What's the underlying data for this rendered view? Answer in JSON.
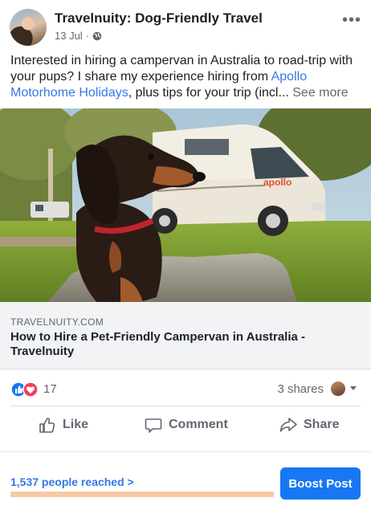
{
  "post": {
    "page_name": "Travelnuity: Dog-Friendly Travel",
    "date": "13 Jul",
    "separator": "·",
    "privacy_icon": "globe-icon",
    "more_icon": "ellipsis-icon",
    "text_intro": "Interested in hiring a campervan in Australia to road-trip with your pups? I share my experience hiring from ",
    "text_link": "Apollo Motorhome Holidays",
    "text_rest": ", plus tips for your trip (incl...",
    "see_more": " See more"
  },
  "link_preview": {
    "domain": "TRAVELNUITY.COM",
    "title": "How to Hire a Pet-Friendly Campervan in Australia - Travelnuity",
    "image_icon": "dachshund-campervan-photo",
    "van_brand": "apollo"
  },
  "engagement": {
    "reactions_count": "17",
    "reaction_icons": [
      "like-icon",
      "love-icon"
    ],
    "shares": "3 shares"
  },
  "actions": [
    {
      "label": "Like",
      "icon": "thumbs-up-icon"
    },
    {
      "label": "Comment",
      "icon": "comment-icon"
    },
    {
      "label": "Share",
      "icon": "share-icon"
    }
  ],
  "footer": {
    "reach": "1,537 people reached",
    "reach_chevron": ">",
    "boost_label": "Boost Post"
  },
  "colors": {
    "accent": "#1877f2",
    "link": "#3578e5",
    "love": "#f33e58",
    "reach_bar": "#f7c9a4"
  }
}
